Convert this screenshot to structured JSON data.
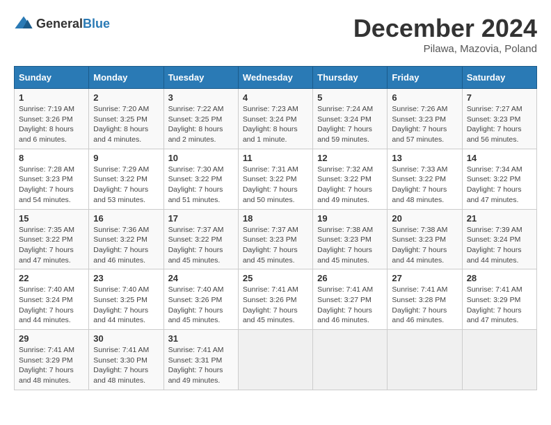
{
  "header": {
    "logo": {
      "general": "General",
      "blue": "Blue"
    },
    "title": "December 2024",
    "location": "Pilawa, Mazovia, Poland"
  },
  "calendar": {
    "headers": [
      "Sunday",
      "Monday",
      "Tuesday",
      "Wednesday",
      "Thursday",
      "Friday",
      "Saturday"
    ],
    "weeks": [
      [
        null,
        {
          "day": "2",
          "sunrise": "Sunrise: 7:20 AM",
          "sunset": "Sunset: 3:25 PM",
          "daylight": "Daylight: 8 hours and 4 minutes."
        },
        {
          "day": "3",
          "sunrise": "Sunrise: 7:22 AM",
          "sunset": "Sunset: 3:25 PM",
          "daylight": "Daylight: 8 hours and 2 minutes."
        },
        {
          "day": "4",
          "sunrise": "Sunrise: 7:23 AM",
          "sunset": "Sunset: 3:24 PM",
          "daylight": "Daylight: 8 hours and 1 minute."
        },
        {
          "day": "5",
          "sunrise": "Sunrise: 7:24 AM",
          "sunset": "Sunset: 3:24 PM",
          "daylight": "Daylight: 7 hours and 59 minutes."
        },
        {
          "day": "6",
          "sunrise": "Sunrise: 7:26 AM",
          "sunset": "Sunset: 3:23 PM",
          "daylight": "Daylight: 7 hours and 57 minutes."
        },
        {
          "day": "7",
          "sunrise": "Sunrise: 7:27 AM",
          "sunset": "Sunset: 3:23 PM",
          "daylight": "Daylight: 7 hours and 56 minutes."
        }
      ],
      [
        {
          "day": "1",
          "sunrise": "Sunrise: 7:19 AM",
          "sunset": "Sunset: 3:26 PM",
          "daylight": "Daylight: 8 hours and 6 minutes."
        },
        {
          "day": "8",
          "sunrise": "Sunrise: 7:28 AM",
          "sunset": "Sunset: 3:23 PM",
          "daylight": "Daylight: 7 hours and 54 minutes."
        },
        {
          "day": "9",
          "sunrise": "Sunrise: 7:29 AM",
          "sunset": "Sunset: 3:22 PM",
          "daylight": "Daylight: 7 hours and 53 minutes."
        },
        {
          "day": "10",
          "sunrise": "Sunrise: 7:30 AM",
          "sunset": "Sunset: 3:22 PM",
          "daylight": "Daylight: 7 hours and 51 minutes."
        },
        {
          "day": "11",
          "sunrise": "Sunrise: 7:31 AM",
          "sunset": "Sunset: 3:22 PM",
          "daylight": "Daylight: 7 hours and 50 minutes."
        },
        {
          "day": "12",
          "sunrise": "Sunrise: 7:32 AM",
          "sunset": "Sunset: 3:22 PM",
          "daylight": "Daylight: 7 hours and 49 minutes."
        },
        {
          "day": "13",
          "sunrise": "Sunrise: 7:33 AM",
          "sunset": "Sunset: 3:22 PM",
          "daylight": "Daylight: 7 hours and 48 minutes."
        },
        {
          "day": "14",
          "sunrise": "Sunrise: 7:34 AM",
          "sunset": "Sunset: 3:22 PM",
          "daylight": "Daylight: 7 hours and 47 minutes."
        }
      ],
      [
        {
          "day": "15",
          "sunrise": "Sunrise: 7:35 AM",
          "sunset": "Sunset: 3:22 PM",
          "daylight": "Daylight: 7 hours and 47 minutes."
        },
        {
          "day": "16",
          "sunrise": "Sunrise: 7:36 AM",
          "sunset": "Sunset: 3:22 PM",
          "daylight": "Daylight: 7 hours and 46 minutes."
        },
        {
          "day": "17",
          "sunrise": "Sunrise: 7:37 AM",
          "sunset": "Sunset: 3:22 PM",
          "daylight": "Daylight: 7 hours and 45 minutes."
        },
        {
          "day": "18",
          "sunrise": "Sunrise: 7:37 AM",
          "sunset": "Sunset: 3:23 PM",
          "daylight": "Daylight: 7 hours and 45 minutes."
        },
        {
          "day": "19",
          "sunrise": "Sunrise: 7:38 AM",
          "sunset": "Sunset: 3:23 PM",
          "daylight": "Daylight: 7 hours and 45 minutes."
        },
        {
          "day": "20",
          "sunrise": "Sunrise: 7:38 AM",
          "sunset": "Sunset: 3:23 PM",
          "daylight": "Daylight: 7 hours and 44 minutes."
        },
        {
          "day": "21",
          "sunrise": "Sunrise: 7:39 AM",
          "sunset": "Sunset: 3:24 PM",
          "daylight": "Daylight: 7 hours and 44 minutes."
        }
      ],
      [
        {
          "day": "22",
          "sunrise": "Sunrise: 7:40 AM",
          "sunset": "Sunset: 3:24 PM",
          "daylight": "Daylight: 7 hours and 44 minutes."
        },
        {
          "day": "23",
          "sunrise": "Sunrise: 7:40 AM",
          "sunset": "Sunset: 3:25 PM",
          "daylight": "Daylight: 7 hours and 44 minutes."
        },
        {
          "day": "24",
          "sunrise": "Sunrise: 7:40 AM",
          "sunset": "Sunset: 3:26 PM",
          "daylight": "Daylight: 7 hours and 45 minutes."
        },
        {
          "day": "25",
          "sunrise": "Sunrise: 7:41 AM",
          "sunset": "Sunset: 3:26 PM",
          "daylight": "Daylight: 7 hours and 45 minutes."
        },
        {
          "day": "26",
          "sunrise": "Sunrise: 7:41 AM",
          "sunset": "Sunset: 3:27 PM",
          "daylight": "Daylight: 7 hours and 46 minutes."
        },
        {
          "day": "27",
          "sunrise": "Sunrise: 7:41 AM",
          "sunset": "Sunset: 3:28 PM",
          "daylight": "Daylight: 7 hours and 46 minutes."
        },
        {
          "day": "28",
          "sunrise": "Sunrise: 7:41 AM",
          "sunset": "Sunset: 3:29 PM",
          "daylight": "Daylight: 7 hours and 47 minutes."
        }
      ],
      [
        {
          "day": "29",
          "sunrise": "Sunrise: 7:41 AM",
          "sunset": "Sunset: 3:29 PM",
          "daylight": "Daylight: 7 hours and 48 minutes."
        },
        {
          "day": "30",
          "sunrise": "Sunrise: 7:41 AM",
          "sunset": "Sunset: 3:30 PM",
          "daylight": "Daylight: 7 hours and 48 minutes."
        },
        {
          "day": "31",
          "sunrise": "Sunrise: 7:41 AM",
          "sunset": "Sunset: 3:31 PM",
          "daylight": "Daylight: 7 hours and 49 minutes."
        },
        null,
        null,
        null,
        null
      ]
    ]
  }
}
